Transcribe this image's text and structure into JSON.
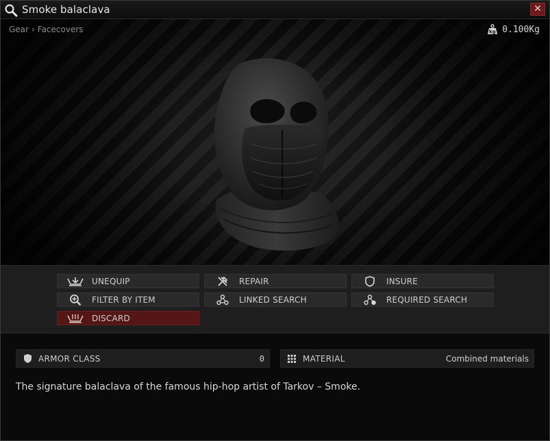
{
  "window": {
    "title": "Smoke balaclava",
    "close_label": "✕"
  },
  "header": {
    "breadcrumb": [
      "Gear",
      "Facecovers"
    ],
    "breadcrumb_separator": "›",
    "weight": "0.100Kg"
  },
  "actions": [
    {
      "label": "UNEQUIP",
      "icon": "unequip-icon"
    },
    {
      "label": "REPAIR",
      "icon": "repair-icon"
    },
    {
      "label": "INSURE",
      "icon": "shield-icon"
    },
    {
      "label": "FILTER BY ITEM",
      "icon": "magnify-plus-icon"
    },
    {
      "label": "LINKED SEARCH",
      "icon": "linked-search-icon"
    },
    {
      "label": "REQUIRED SEARCH",
      "icon": "required-search-icon"
    },
    {
      "label": "DISCARD",
      "icon": "discard-icon"
    }
  ],
  "stats": [
    {
      "label": "ARMOR CLASS",
      "value": "0",
      "icon": "armor-shield-icon"
    },
    {
      "label": "MATERIAL",
      "value": "Combined materials",
      "icon": "material-grid-icon"
    }
  ],
  "description": "The signature balaclava of the famous hip-hop artist of Tarkov – Smoke.",
  "colors": {
    "close_button": "#6a1a1a",
    "discard_button": "#541616",
    "button_bg": "#2a2a2a",
    "panel_bg": "#1e1e1e"
  }
}
